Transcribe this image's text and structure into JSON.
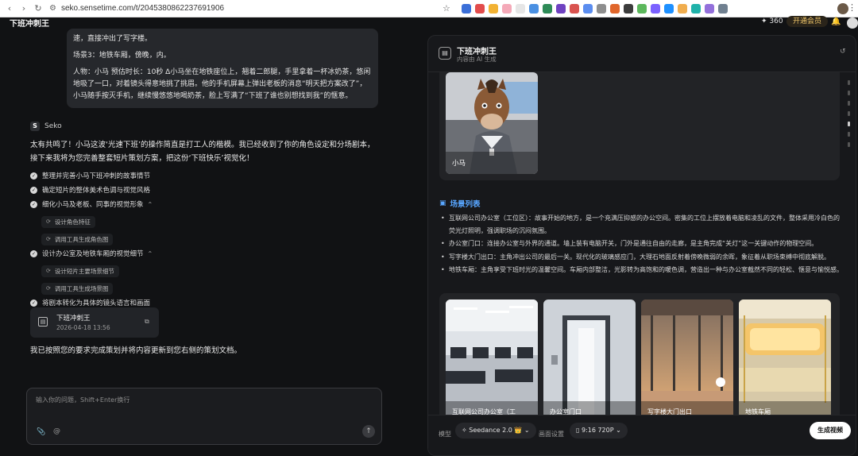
{
  "browser": {
    "url": "seko.sensetime.com/t/2045380862237691906"
  },
  "appbar": {
    "title": "下班冲刺王",
    "credits": "✦ 360",
    "vip_label": "开通会员"
  },
  "chat": {
    "user_message": {
      "line1": "速，直接冲出了写字楼。",
      "line2": "场景3：地铁车厢，傍晚，内。",
      "line3": "人物：小马 预估时长：10秒 Δ小马坐在地铁座位上，翘着二郎腿，手里拿着一杯冰奶茶，悠闲地吸了一口，对着镜头得意地挑了挑眉。他的手机屏幕上弹出老板的消息“明天把方案改了”，小马随手按灭手机，继续慢悠悠地喝奶茶，脸上写满了“下班了谁也别想找到我”的惬意。"
    },
    "assistant_name": "Seko",
    "assistant_intro": "太有共鸣了！小马这波‘光速下班’的操作简直是打工人的楷模。我已经收到了你的角色设定和分场剧本，接下来我将为您完善整套短片策划方案，把这份‘下班快乐’视觉化！",
    "tasks": [
      {
        "label": "整理并完善小马下班冲刺的故事情节"
      },
      {
        "label": "确定短片的整体美术色调与视觉风格"
      },
      {
        "label": "细化小马及老板、同事的视觉形象"
      },
      {
        "label": "设计办公室及地铁车厢的视觉细节"
      },
      {
        "label": "将剧本转化为具体的镜头语言和画面"
      }
    ],
    "subtasks": {
      "a1": "设计角色特征",
      "a2": "调用工具生成角色图",
      "b1": "设计短片主要场景细节",
      "b2": "调用工具生成场景图"
    },
    "doc_card": {
      "title": "下班冲刺王",
      "date": "2026-04-18 13:56"
    },
    "assistant_final": "我已按照您的要求完成策划并将内容更新到您右侧的策划文档。",
    "composer": {
      "placeholder": "输入你的问题，Shift+Enter换行"
    }
  },
  "doc": {
    "title": "下班冲刺王",
    "subtitle": "内容由 AI 生成",
    "character": {
      "name": "小马"
    },
    "scene_section_title": "场景列表",
    "scenes_text": [
      "互联网公司办公室（工位区）：故事开始的地方，是一个充满压抑感的办公空间。密集的工位上摆放着电脑和凌乱的文件，整体采用冷白色的荧光灯照明，强调职场的沉闷氛围。",
      "办公室门口：连接办公室与外界的通道。墙上装有电脑开关，门外是通往自由的走廊，是主角完成“关灯”这一关键动作的物理空间。",
      "写字楼大门出口：主角冲出公司的最后一关。现代化的玻璃感应门，大理石地面反射着傍晚微弱的余晖，象征着从职场束缚中彻底解脱。",
      "地铁车厢：主角享受下班时光的温馨空间。车厢内部整洁，光影转为高饱和的暖色调，营造出一种与办公室截然不同的轻松、惬意与愉悦感。"
    ],
    "scene_cards": [
      {
        "caption": "互联网公司办公室（工"
      },
      {
        "caption": "办公室门口"
      },
      {
        "caption": "写字楼大门出口"
      },
      {
        "caption": "地铁车厢"
      }
    ],
    "toolbar": {
      "model_label": "模型",
      "model_value": "Seedance 2.0 👑",
      "canvas_label": "画面设置",
      "ratio_value": "9:16  720P",
      "generate_label": "生成视频"
    }
  },
  "colors": {
    "background": "#111214",
    "panel": "#17181b",
    "accent_blue": "#58a6ff",
    "vip_gold": "#f1c76a"
  }
}
